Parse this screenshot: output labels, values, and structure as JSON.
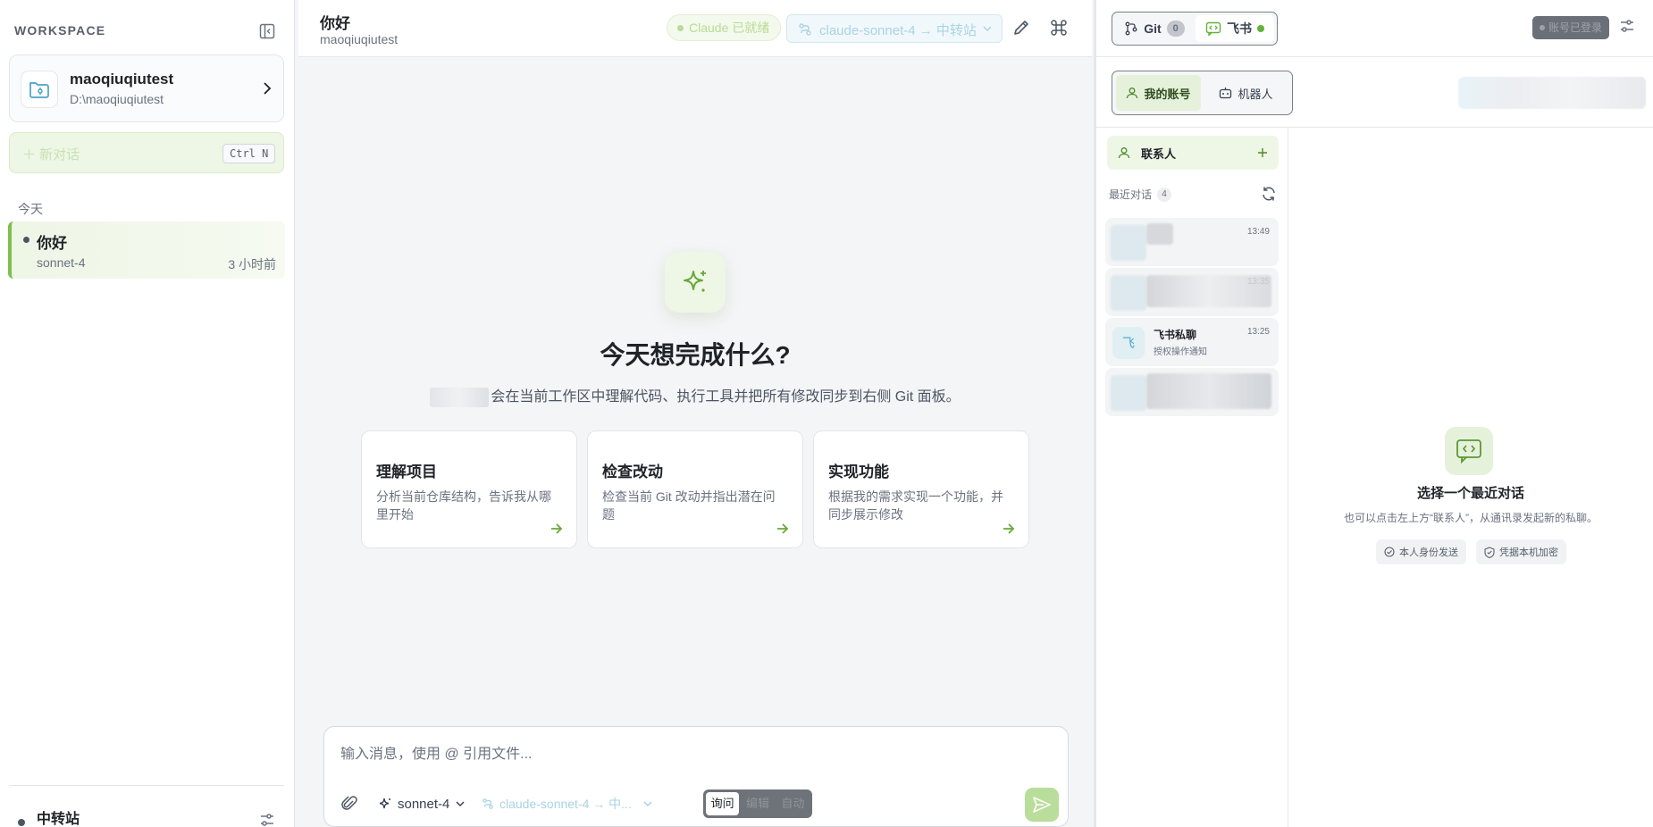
{
  "sidebar": {
    "workspace_label": "WORKSPACE",
    "workspace": {
      "name": "maoqiuqiutest",
      "path": "D:\\maoqiuqiutest"
    },
    "new_chat": {
      "label": "新对话",
      "shortcut": "Ctrl N"
    },
    "group_today": "今天",
    "conversation": {
      "title": "你好",
      "model": "sonnet-4",
      "time": "3 小时前"
    },
    "relay_label": "中转站"
  },
  "header": {
    "title": "你好",
    "subtitle": "maoqiuqiutest",
    "status_badge": "Claude 已就绪",
    "model_route": "claude-sonnet-4 → 中转站"
  },
  "hero": {
    "title": "今天想完成什么?",
    "description_suffix": "会在当前工作区中理解代码、执行工具并把所有修改同步到右侧 Git 面板。"
  },
  "cards": [
    {
      "title": "理解项目",
      "desc": "分析当前仓库结构，告诉我从哪里开始"
    },
    {
      "title": "检查改动",
      "desc": "检查当前 Git 改动并指出潜在问题"
    },
    {
      "title": "实现功能",
      "desc": "根据我的需求实现一个功能，并同步展示修改"
    }
  ],
  "composer": {
    "placeholder": "输入消息，使用 @ 引用文件...",
    "model": "sonnet-4",
    "route": "claude-sonnet-4 → 中...",
    "modes": [
      "询问",
      "编辑",
      "自动"
    ],
    "active_mode": "询问"
  },
  "right": {
    "tabs": [
      {
        "label": "Git",
        "count": "0"
      },
      {
        "label": "飞书"
      }
    ],
    "logged_badge": "账号已登录",
    "account_tabs": [
      "我的账号",
      "机器人"
    ],
    "contacts_label": "联系人",
    "recent_label": "最近对话",
    "recent_count": "4",
    "threads": [
      {
        "time": "13:49"
      },
      {
        "time": "13:35"
      },
      {
        "name": "飞书私聊",
        "sub": "授权操作通知",
        "time": "13:25",
        "avatar": "飞"
      },
      {
        "time": ""
      }
    ],
    "empty": {
      "title": "选择一个最近对话",
      "desc": "也可以点击左上方“联系人”，从通讯录发起新的私聊。",
      "chips": [
        "本人身份发送",
        "凭据本机加密"
      ]
    }
  },
  "colors": {
    "accent": "#7fbf4a",
    "accent_light": "#eef6e6",
    "route_blue": "#a9d3e4"
  }
}
